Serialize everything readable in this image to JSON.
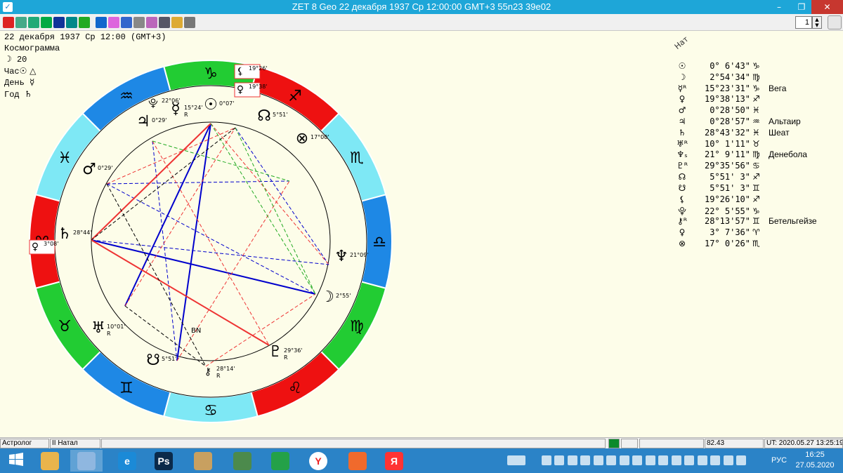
{
  "window": {
    "title": "ZET 8 Geo   22 декабря 1937  Ср  12:00:00 GMT+3 55n23  39e02",
    "minimize": "–",
    "maximize": "❐",
    "close": "✕"
  },
  "toolbar": {
    "zoom_value": "1",
    "icons": [
      "red-gear-icon",
      "table-icon",
      "globe-icon",
      "calendar-icon",
      "starmap-icon",
      "chart-grid-icon",
      "map-icon",
      "planets-icon",
      "pointer-icon",
      "document-icon",
      "aspects-icon",
      "camera-icon",
      "settings-icon",
      "lightbulb-icon",
      "cascade-icon"
    ]
  },
  "info": {
    "date_line": "22 декабря 1937  Ср  12:00 (GMT+3)",
    "chart_type": "Космограмма",
    "moon_glyph": "☽",
    "moon_value": "20",
    "hour_label": "Час",
    "hour_glyphs": "☉ △",
    "day_label": "День",
    "day_glyph": "☿",
    "year_label": "Год",
    "year_glyph": "♄"
  },
  "natal_label": "Нат",
  "positions": [
    {
      "glyph": "☉",
      "value": "0° 6'43\"",
      "sign": "♑",
      "star": ""
    },
    {
      "glyph": "☽",
      "value": "2°54'34\"",
      "sign": "♍",
      "star": ""
    },
    {
      "glyph": "☿ᴿ",
      "value": "15°23'31\"",
      "sign": "♑",
      "star": "Вега"
    },
    {
      "glyph": "♀",
      "value": "19°38'13\"",
      "sign": "♐",
      "star": ""
    },
    {
      "glyph": "♂",
      "value": "0°28'50\"",
      "sign": "♓",
      "star": ""
    },
    {
      "glyph": "♃",
      "value": "0°28'57\"",
      "sign": "♒",
      "star": "Альтаир"
    },
    {
      "glyph": "♄",
      "value": "28°43'32\"",
      "sign": "♓",
      "star": "Шеат"
    },
    {
      "glyph": "♅ᴿ",
      "value": "10° 1'11\"",
      "sign": "♉",
      "star": ""
    },
    {
      "glyph": "♆ₛ",
      "value": "21° 9'11\"",
      "sign": "♍",
      "star": "Денебола"
    },
    {
      "glyph": "♇ᴿ",
      "value": "29°35'56\"",
      "sign": "♋",
      "star": ""
    },
    {
      "glyph": "☊",
      "value": "5°51' 3\"",
      "sign": "♐",
      "star": ""
    },
    {
      "glyph": "☋",
      "value": "5°51' 3\"",
      "sign": "♊",
      "star": ""
    },
    {
      "glyph": "⚸",
      "value": "19°26'10\"",
      "sign": "♐",
      "star": ""
    },
    {
      "glyph": "⯓",
      "value": "22° 5'55\"",
      "sign": "♑",
      "star": ""
    },
    {
      "glyph": "⚷ᴿ",
      "value": "28°13'57\"",
      "sign": "♊",
      "star": "Бетельгейзе"
    },
    {
      "glyph": "♀",
      "value": "3° 7'36\"",
      "sign": "♈",
      "star": ""
    },
    {
      "glyph": "⊗",
      "value": "17° 0'26\"",
      "sign": "♏",
      "star": ""
    }
  ],
  "zodiac": [
    {
      "glyph": "♈",
      "color": "#ee1111"
    },
    {
      "glyph": "♉",
      "color": "#22cc33"
    },
    {
      "glyph": "♊",
      "color": "#1e88e5"
    },
    {
      "glyph": "♋",
      "color": "#7ee8f5"
    },
    {
      "glyph": "♌",
      "color": "#ee1111"
    },
    {
      "glyph": "♍",
      "color": "#22cc33"
    },
    {
      "glyph": "♎",
      "color": "#1e88e5"
    },
    {
      "glyph": "♏",
      "color": "#7ee8f5"
    },
    {
      "glyph": "♐",
      "color": "#ee1111"
    },
    {
      "glyph": "♑",
      "color": "#22cc33"
    },
    {
      "glyph": "♒",
      "color": "#1e88e5"
    },
    {
      "glyph": "♓",
      "color": "#7ee8f5"
    }
  ],
  "chart_planets": [
    {
      "glyph": "☉",
      "label": "0°07'"
    },
    {
      "glyph": "☿",
      "label": "15°24'",
      "retro": "R"
    },
    {
      "glyph": "⯓",
      "label": "22°06'"
    },
    {
      "glyph": "♃",
      "label": "0°29'"
    },
    {
      "glyph": "♂",
      "label": "0°29'"
    },
    {
      "glyph": "♄",
      "label": "28°44'"
    },
    {
      "glyph": "♅",
      "label": "10°01'",
      "retro": "R"
    },
    {
      "glyph": "☋",
      "label": "5°51'"
    },
    {
      "glyph": "⚷",
      "label": "28°14'",
      "retro": "R"
    },
    {
      "glyph": "♇",
      "label": "29°36'",
      "retro": "R"
    },
    {
      "glyph": "☽",
      "label": "2°55'"
    },
    {
      "glyph": "♆",
      "label": "21°09'"
    },
    {
      "glyph": "⊗",
      "label": "17°00'"
    },
    {
      "glyph": "☊",
      "label": "5°51'"
    },
    {
      "glyph": "⚸",
      "label": "19°26'"
    },
    {
      "glyph": "♀",
      "label": "19°38'"
    },
    {
      "glyph": "♀",
      "label": "3°08'"
    }
  ],
  "center_label": "BN",
  "statusbar": {
    "cell1": "Астролог",
    "cell2": "II Натал",
    "cell3": "82.43",
    "cell4": "UT: 2020.05.27 13:25:19"
  },
  "taskbar": {
    "apps": [
      {
        "name": "start-button",
        "label": "",
        "color": ""
      },
      {
        "name": "explorer-app",
        "label": "",
        "color": "#e9b44c"
      },
      {
        "name": "zet-app",
        "label": "",
        "color": "#8fb7e0"
      },
      {
        "name": "ie-app",
        "label": "e",
        "color": "#1b8ad7"
      },
      {
        "name": "photoshop-app",
        "label": "Ps",
        "color": "#0b2a4a"
      },
      {
        "name": "scanner-app",
        "label": "",
        "color": "#c8a060"
      },
      {
        "name": "solitaire-app",
        "label": "",
        "color": "#4c8a4c"
      },
      {
        "name": "store-app",
        "label": "",
        "color": "#24a148"
      },
      {
        "name": "yandex-browser-app",
        "label": "Y",
        "color": "#ffffff"
      },
      {
        "name": "media-app",
        "label": "",
        "color": "#f06a2c"
      },
      {
        "name": "yandex-app",
        "label": "Я",
        "color": "#f33"
      }
    ],
    "lang": "РУС",
    "time": "16:25",
    "date": "27.05.2020"
  }
}
